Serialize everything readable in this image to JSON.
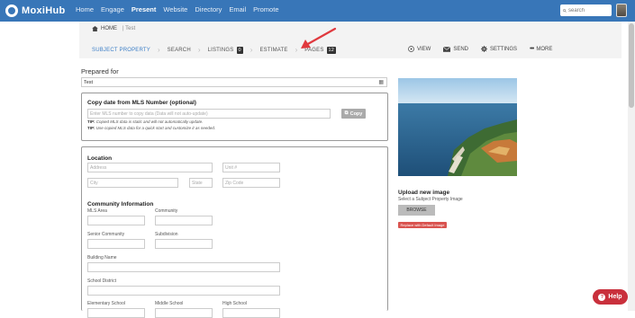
{
  "app": {
    "logo_text": "MoxiHub"
  },
  "nav": {
    "items": [
      "Home",
      "Engage",
      "Present",
      "Website",
      "Directory",
      "Email",
      "Promote"
    ],
    "active": "Present"
  },
  "search": {
    "placeholder": "search"
  },
  "breadcrumb": {
    "home": "HOME",
    "current": "Test"
  },
  "steps": [
    {
      "label": "SUBJECT PROPERTY"
    },
    {
      "label": "SEARCH"
    },
    {
      "label": "LISTINGS",
      "badge": "0"
    },
    {
      "label": "ESTIMATE"
    },
    {
      "label": "PAGES",
      "badge": "12"
    }
  ],
  "actions": {
    "view": "VIEW",
    "send": "SEND",
    "settings": "SETTINGS",
    "more": "MORE"
  },
  "prepared": {
    "label": "Prepared for",
    "value": "Test"
  },
  "mls": {
    "title": "Copy date from MLS Number (optional)",
    "placeholder": "Enter MLS number to copy data (Data will not auto-update)",
    "tip_label": "TIP:",
    "tip1": "Copied MLS data is static and will not automatically update.",
    "tip2": "Use copied MLS data for a quick start and customize it as needed.",
    "copy_label": "Copy"
  },
  "location": {
    "title": "Location",
    "address": "Address",
    "unit": "Unit #",
    "city": "City",
    "state": "State",
    "zip": "Zip Code"
  },
  "community": {
    "title": "Community Information",
    "mls_area": "MLS Area",
    "community": "Community",
    "senior": "Senior Community",
    "subdivision": "Subdivision",
    "building": "Building Name",
    "school_district": "School District",
    "elementary": "Elementary School",
    "middle": "Middle School",
    "high": "High School"
  },
  "upload": {
    "title": "Upload new image",
    "subtitle": "Select a Subject Property Image",
    "browse": "BROWSE",
    "replace": "Replace with Default Image"
  },
  "help": {
    "label": "Help"
  },
  "colors": {
    "topbar": "#3876b8",
    "active_step": "#3b7ec7",
    "help": "#c9303c",
    "replace": "#d9534f",
    "arrow": "#e0393e"
  }
}
